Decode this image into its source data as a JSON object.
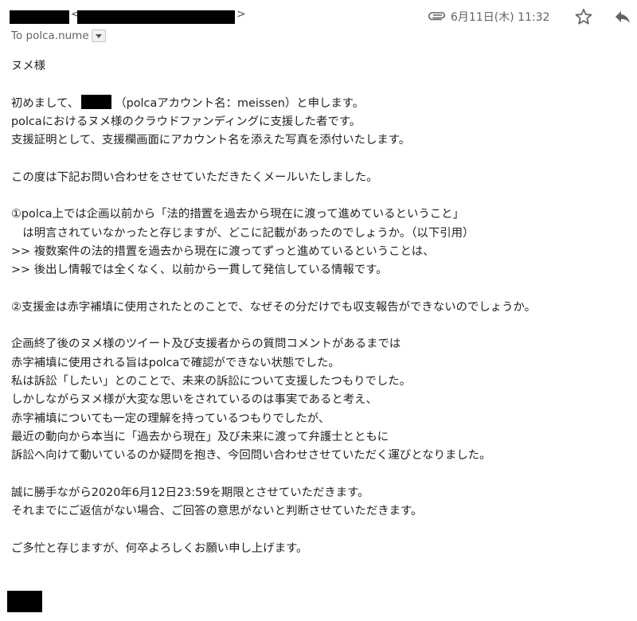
{
  "header": {
    "sender_open_bracket": "<",
    "sender_close_bracket": ">",
    "to_label": "To polca.nume",
    "date": "6月11日(木) 11:32",
    "icons": {
      "attachment": "paperclip-icon",
      "details": "chevron-down-icon",
      "star": "star-icon",
      "reply": "reply-icon"
    }
  },
  "body": {
    "greeting": "ヌメ様",
    "p1_l1_before": "初めまして、",
    "p1_l1_after": "（polcaアカウント名：meissen）と申します。",
    "p1_l2": "polcaにおけるヌメ様のクラウドファンディングに支援した者です。",
    "p1_l3": "支援証明として、支援欄画面にアカウント名を添えた写真を添付いたします。",
    "p2": "この度は下記お問い合わせをさせていただきたくメールいたしました。",
    "q1_l1": "①polca上では企画以前から「法的措置を過去から現在に渡って進めているということ」",
    "q1_l2": "　は明言されていなかったと存じますが、どこに記載があったのでしょうか。（以下引用）",
    "q1_l3": ">> 複数案件の法的措置を過去から現在に渡ってずっと進めているということは、",
    "q1_l4": ">> 後出し情報では全くなく、以前から一貫して発信している情報です。",
    "q2": "②支援金は赤字補填に使用されたとのことで、なぜその分だけでも収支報告ができないのでしょうか。",
    "p3_l1": "企画終了後のヌメ様のツイート及び支援者からの質問コメントがあるまでは",
    "p3_l2": "赤字補填に使用される旨はpolcaで確認ができない状態でした。",
    "p3_l3": "私は訴訟「したい」とのことで、未来の訴訟について支援したつもりでした。",
    "p3_l4": "しかしながらヌメ様が大変な思いをされているのは事実であると考え、",
    "p3_l5": "赤字補填についても一定の理解を持っているつもりでしたが、",
    "p3_l6": "最近の動向から本当に「過去から現在」及び未来に渡って弁護士とともに",
    "p3_l7": "訴訟へ向けて動いているのか疑問を抱き、今回問い合わせさせていただく運びとなりました。",
    "p4_l1": "誠に勝手ながら2020年6月12日23:59を期限とさせていただきます。",
    "p4_l2": "それまでにご返信がない場合、ご回答の意思がないと判断させていただきます。",
    "closing": "ご多忙と存じますが、何卒よろしくお願い申し上げます。"
  },
  "colors": {
    "text": "#222222",
    "meta_text": "#5f6368",
    "redaction": "#000000"
  }
}
